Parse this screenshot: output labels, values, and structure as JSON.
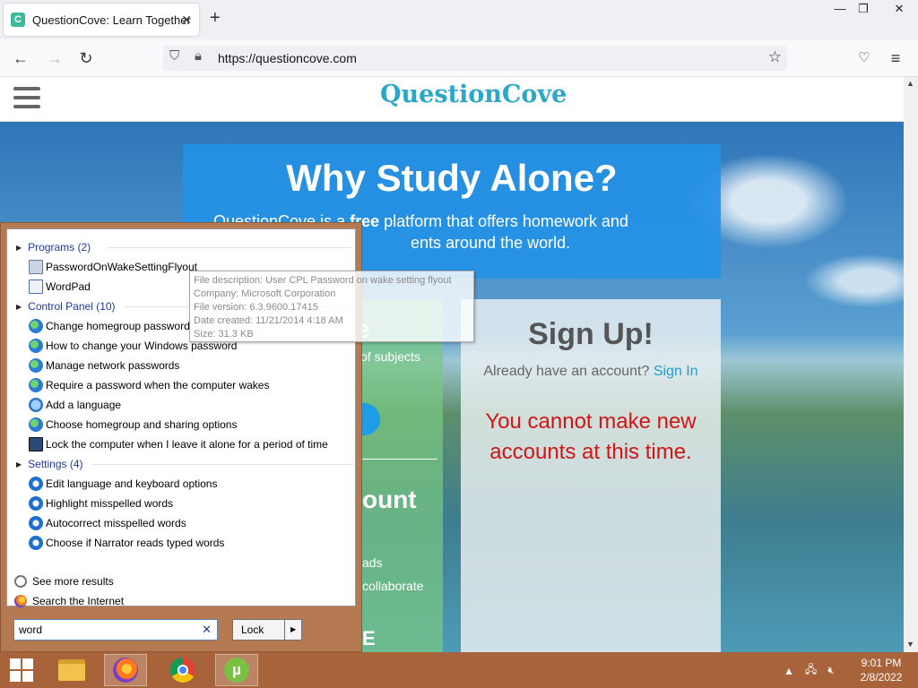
{
  "browser": {
    "tab_title": "QuestionCove: Learn Together",
    "favicon_letter": "C",
    "url": "https://questioncove.com",
    "window_controls": {
      "minimize": "—",
      "restore": "❐",
      "close": "✕"
    }
  },
  "site": {
    "logo": "QuestionCove",
    "hero_title": "Why Study Alone?",
    "tagline_pre": "QuestionCove is a ",
    "tagline_bold": "free",
    "tagline_post": " platform that offers homework and",
    "tagline_line2": "ents around the world.",
    "left_panel": {
      "heading1": "de",
      "text1": "of subjects",
      "heading2": "ount",
      "text2": "ads",
      "text3": "collaborate",
      "text4": "E"
    },
    "signup": {
      "title": "Sign Up!",
      "have_account": "Already have an account?",
      "sign_in": "Sign In",
      "error": "You cannot make new accounts at this time."
    }
  },
  "startmenu": {
    "groups": [
      {
        "label": "Programs (2)"
      },
      {
        "label": "Control Panel (10)"
      },
      {
        "label": "Settings (4)"
      }
    ],
    "programs": [
      "PasswordOnWakeSettingFlyout",
      "WordPad"
    ],
    "control_panel": [
      "Change homegroup password",
      "How to change your Windows password",
      "Manage network passwords",
      "Require a password when the computer wakes",
      "Add a language",
      "Choose homegroup and sharing options",
      "Lock the computer when I leave it alone for a period of time"
    ],
    "settings": [
      "Edit language and keyboard options",
      "Highlight misspelled words",
      "Autocorrect misspelled words",
      "Choose if Narrator reads typed words"
    ],
    "see_more": "See more results",
    "search_internet": "Search the Internet",
    "search_value": "word",
    "lock_label": "Lock"
  },
  "tooltip": {
    "description": "File description: User CPL Password on wake setting flyout",
    "company": "Company: Microsoft Corporation",
    "version": "File version: 6.3.9600.17415",
    "created": "Date created: 11/21/2014 4:18 AM",
    "size": "Size: 31.3 KB"
  },
  "taskbar": {
    "time": "9:01 PM",
    "date": "2/8/2022"
  }
}
